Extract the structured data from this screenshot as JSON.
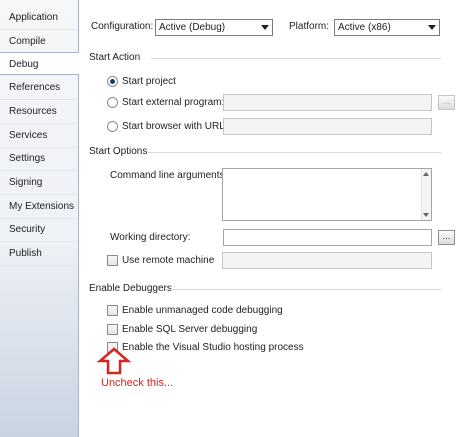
{
  "sidebar": {
    "tabs": [
      {
        "label": "Application"
      },
      {
        "label": "Compile"
      },
      {
        "label": "Debug"
      },
      {
        "label": "References"
      },
      {
        "label": "Resources"
      },
      {
        "label": "Services"
      },
      {
        "label": "Settings"
      },
      {
        "label": "Signing"
      },
      {
        "label": "My Extensions"
      },
      {
        "label": "Security"
      },
      {
        "label": "Publish"
      }
    ],
    "active": "Debug"
  },
  "header": {
    "configuration_label": "Configuration:",
    "configuration_value": "Active (Debug)",
    "platform_label": "Platform:",
    "platform_value": "Active (x86)"
  },
  "start_action": {
    "title": "Start Action",
    "start_project": "Start project",
    "start_external": "Start external program:",
    "start_browser": "Start browser with URL:",
    "browse_label": "..."
  },
  "start_options": {
    "title": "Start Options",
    "command_line": "Command line arguments:",
    "command_line_value": "",
    "working_dir": "Working directory:",
    "working_dir_value": "",
    "browse_label": "...",
    "remote_machine": "Use remote machine",
    "remote_machine_value": ""
  },
  "debuggers": {
    "title": "Enable Debuggers",
    "unmanaged": "Enable unmanaged code debugging",
    "sql": "Enable SQL Server debugging",
    "hosting": "Enable the Visual Studio hosting process"
  },
  "annotation": {
    "text": "Uncheck this...",
    "color": "#d4261f"
  }
}
